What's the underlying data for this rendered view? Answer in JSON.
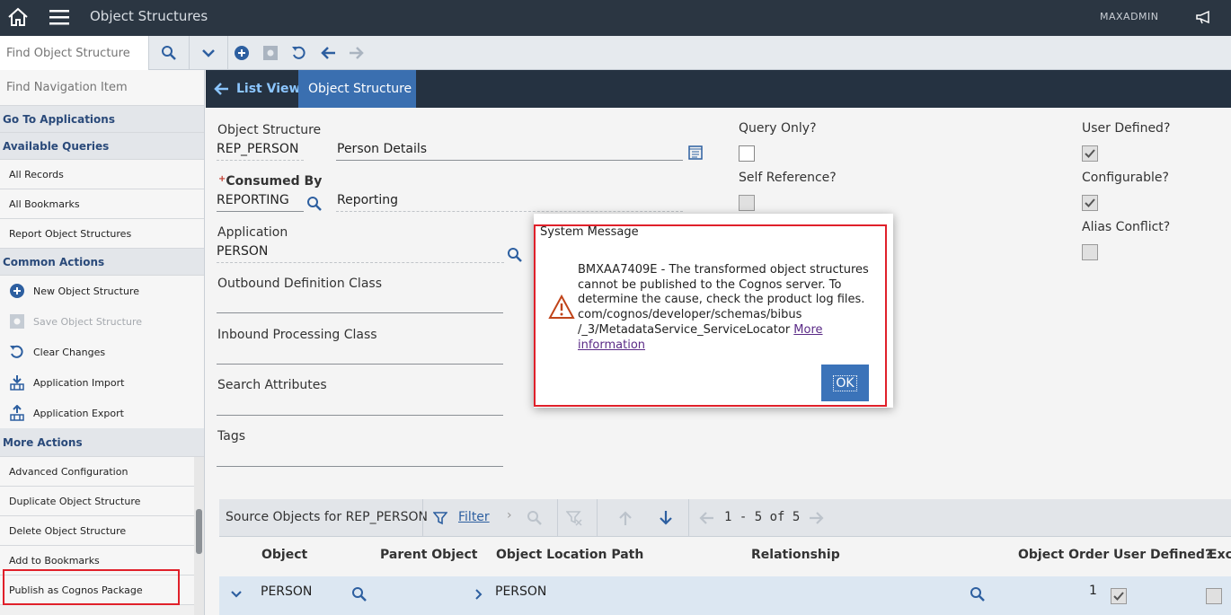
{
  "topbar": {
    "title": "Object Structures",
    "user": "MAXADMIN"
  },
  "toolbar": {
    "find_placeholder": "Find Object Structure"
  },
  "sidebar": {
    "find_placeholder": "Find Navigation Item",
    "go_to": "Go To Applications",
    "queries_head": "Available Queries",
    "queries": [
      "All Records",
      "All Bookmarks",
      "Report Object Structures"
    ],
    "common_head": "Common Actions",
    "common": [
      "New Object Structure",
      "Save Object Structure",
      "Clear Changes",
      "Application Import",
      "Application Export"
    ],
    "more_head": "More Actions",
    "more": [
      "Advanced Configuration",
      "Duplicate Object Structure",
      "Delete Object Structure",
      "Add to Bookmarks",
      "Publish as Cognos Package"
    ]
  },
  "tabs": {
    "list_view": "List View",
    "active": "Object Structure"
  },
  "form": {
    "os_label": "Object Structure",
    "os_value": "REP_PERSON",
    "os_desc": "Person Details",
    "consumed_label": "Consumed By",
    "required_mark": "+",
    "consumed_value": "REPORTING",
    "consumed_desc": "Reporting",
    "app_label": "Application",
    "app_value": "PERSON",
    "outbound_label": "Outbound Definition Class",
    "inbound_label": "Inbound Processing Class",
    "search_label": "Search Attributes",
    "tags_label": "Tags",
    "query_only": "Query Only?",
    "self_ref": "Self Reference?",
    "user_defined": "User Defined?",
    "configurable": "Configurable?",
    "alias_conflict": "Alias Conflict?"
  },
  "table": {
    "title": "Source Objects for REP_PERSON",
    "filter": "Filter",
    "paging": "1 - 5 of 5",
    "columns": [
      "Object",
      "Parent Object",
      "Object Location Path",
      "Relationship",
      "Object Order",
      "User Defined?",
      "Exc"
    ],
    "row": {
      "object": "PERSON",
      "path": "PERSON",
      "order": "1"
    }
  },
  "dialog": {
    "title": "System Message",
    "message": "BMXAA7409E - The transformed object structures cannot be published to the Cognos server. To determine the cause, check the product log files. com/cognos/developer/schemas/bibus /_3/MetadataService_ServiceLocator ",
    "link": "More information",
    "ok": "OK"
  },
  "colors": {
    "topbar": "#2b3642",
    "accent": "#3b73b9",
    "highlight": "#e0202a"
  }
}
